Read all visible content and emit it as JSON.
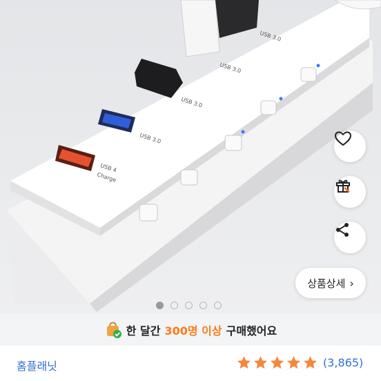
{
  "hero": {
    "labels": {
      "usb30_a": "USB 3.0",
      "usb30_b": "USB 3.0",
      "usb30_c": "USB 3.0",
      "usb30_d": "USB 3.0",
      "usb4_line1": "USB 4",
      "usb4_line2": "Charge"
    },
    "detail_button": {
      "label": "상품상세",
      "chevron": "›"
    },
    "carousel": {
      "count": 5,
      "active_index": 0
    },
    "side_buttons": {
      "like_icon": "heart-icon",
      "gift_icon": "gift-icon",
      "share_icon": "share-icon"
    }
  },
  "banner": {
    "icon": "shopping-bag-check-icon",
    "prefix": "한 달간",
    "highlight": "300명 이상",
    "suffix": "구매했어요",
    "highlight_color": "#ff7a1a"
  },
  "product": {
    "brand": "홈플래닛",
    "rating_stars": 5,
    "review_count": "(3,865)",
    "star_color": "#f5873d"
  }
}
